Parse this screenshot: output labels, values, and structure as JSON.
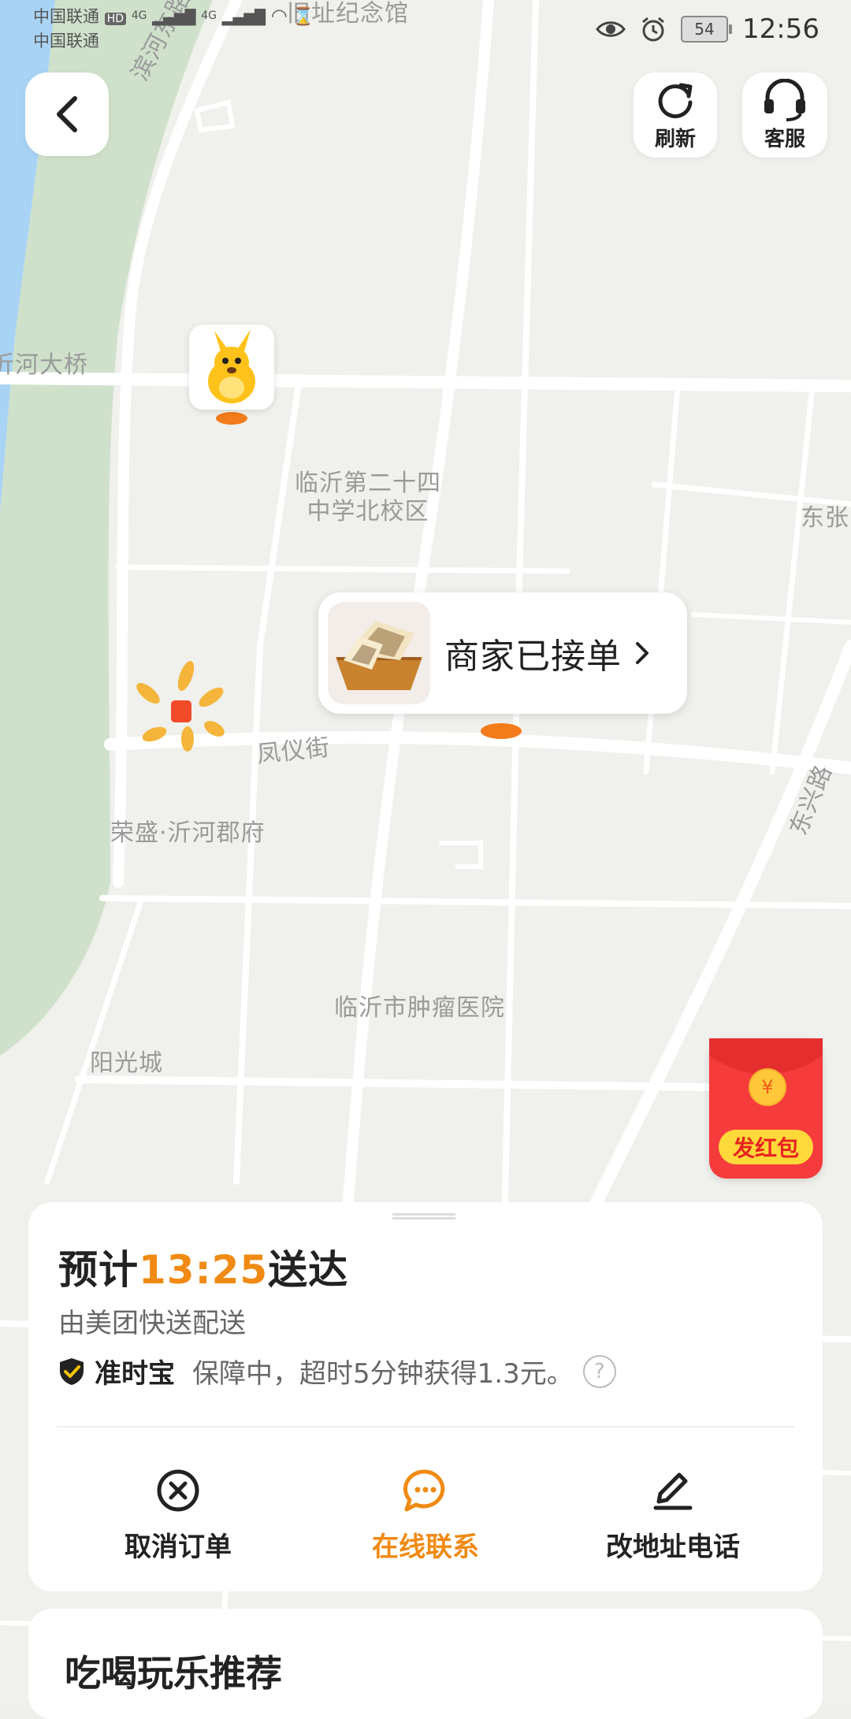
{
  "status_bar": {
    "carrier1": "中国联通",
    "carrier2": "中国联通",
    "hd_badge": "HD",
    "network1": "4G",
    "network2": "4G",
    "battery": "54",
    "time": "12:56",
    "icons": [
      "eye-icon",
      "alarm-icon",
      "hourglass-icon",
      "wifi-icon",
      "signal-icon"
    ]
  },
  "top_buttons": {
    "refresh": "刷新",
    "service": "客服"
  },
  "map": {
    "labels": [
      "旧址纪念馆",
      "滨河东路",
      "沂河大桥",
      "临沂第二十四\n中学北校区",
      "东张",
      "凤仪街",
      "荣盛·沂河郡府",
      "东兴路",
      "临沂市肿瘤医院",
      "阳光城"
    ],
    "colors": {
      "water": "#a9d3f5",
      "green": "#cfe1cb",
      "road": "#ffffff",
      "ground": "#f0f0ec"
    }
  },
  "merchant": {
    "status": "商家已接单"
  },
  "red_envelope": {
    "coin_symbol": "¥",
    "label": "发红包"
  },
  "delivery": {
    "eta_prefix": "预计",
    "eta_time": "13:25",
    "eta_suffix": "送达",
    "deliverer": "由美团快送配送",
    "guarantee_name": "准时宝",
    "guarantee_desc": "保障中，超时5分钟获得1.3元。",
    "help_symbol": "?",
    "accent_color": "#f08a12"
  },
  "actions": [
    {
      "label": "取消订单",
      "icon": "cancel-icon"
    },
    {
      "label": "在线联系",
      "icon": "chat-icon"
    },
    {
      "label": "改地址电话",
      "icon": "edit-icon"
    }
  ],
  "recommend": {
    "title": "吃喝玩乐推荐"
  }
}
